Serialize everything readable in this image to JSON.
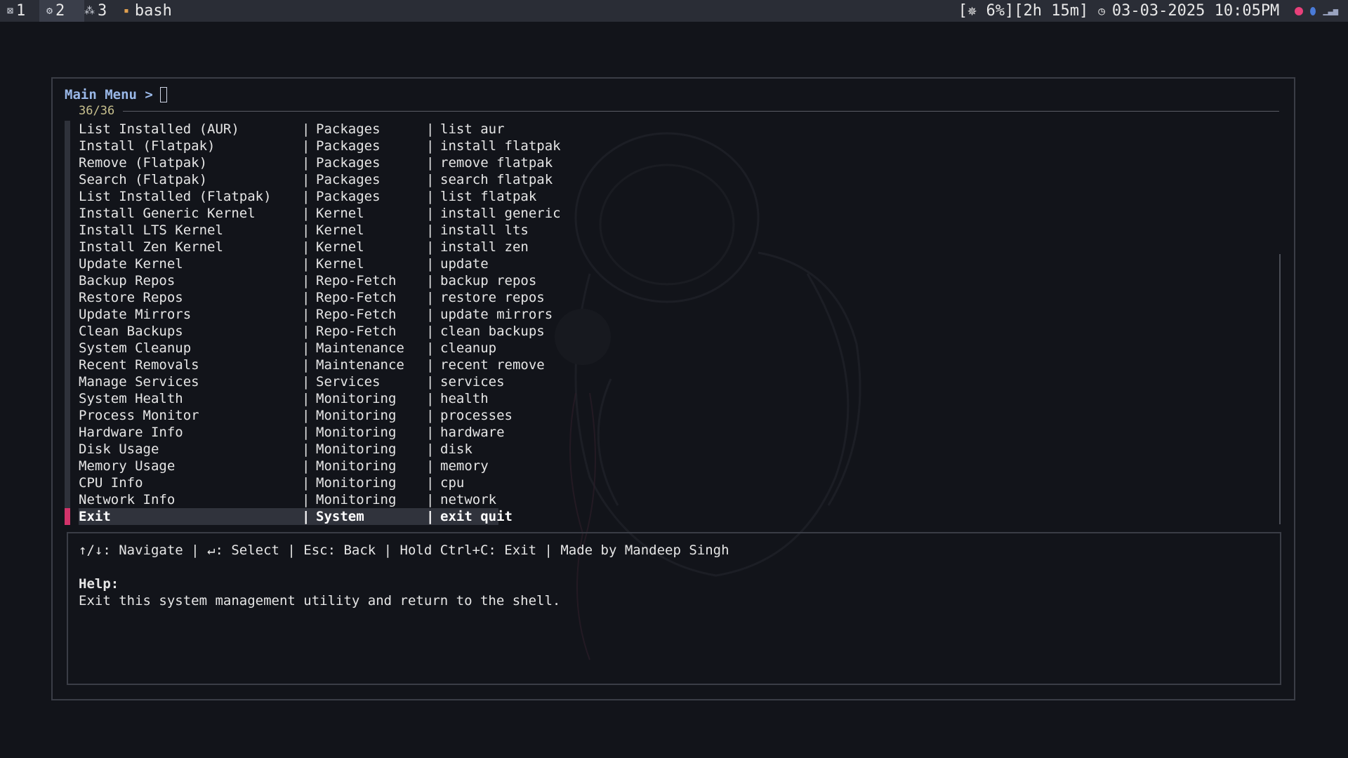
{
  "topbar": {
    "workspaces": [
      {
        "label": "1",
        "icon": "terminal-icon",
        "active": false
      },
      {
        "label": "2",
        "icon": "settings-icon",
        "active": true
      },
      {
        "label": "3",
        "icon": "nodes-icon",
        "active": false
      }
    ],
    "window_title": "bash",
    "status": {
      "cpu": "[✵ 6%]",
      "uptime": "[2h 15m]",
      "clock_icon": "◷",
      "datetime": "03-03-2025 10:05PM"
    },
    "tray_icons": [
      "firefox-icon",
      "bluetooth-icon",
      "signal-icon"
    ],
    "colors": {
      "bar_bg": "#2a2d36",
      "accent": "#d2336a"
    }
  },
  "menu": {
    "prompt": "Main Menu >",
    "counter": "36/36",
    "rows": [
      {
        "name": "List Installed (AUR)",
        "category": "Packages",
        "command": "list aur"
      },
      {
        "name": "Install (Flatpak)",
        "category": "Packages",
        "command": "install flatpak"
      },
      {
        "name": "Remove (Flatpak)",
        "category": "Packages",
        "command": "remove flatpak"
      },
      {
        "name": "Search (Flatpak)",
        "category": "Packages",
        "command": "search flatpak"
      },
      {
        "name": "List Installed (Flatpak)",
        "category": "Packages",
        "command": "list flatpak"
      },
      {
        "name": "Install Generic Kernel",
        "category": "Kernel",
        "command": "install generic"
      },
      {
        "name": "Install LTS Kernel",
        "category": "Kernel",
        "command": "install lts"
      },
      {
        "name": "Install Zen Kernel",
        "category": "Kernel",
        "command": "install zen"
      },
      {
        "name": "Update Kernel",
        "category": "Kernel",
        "command": "update"
      },
      {
        "name": "Backup Repos",
        "category": "Repo-Fetch",
        "command": "backup repos"
      },
      {
        "name": "Restore Repos",
        "category": "Repo-Fetch",
        "command": "restore repos"
      },
      {
        "name": "Update Mirrors",
        "category": "Repo-Fetch",
        "command": "update mirrors"
      },
      {
        "name": "Clean Backups",
        "category": "Repo-Fetch",
        "command": "clean backups"
      },
      {
        "name": "System Cleanup",
        "category": "Maintenance",
        "command": "cleanup"
      },
      {
        "name": "Recent Removals",
        "category": "Maintenance",
        "command": "recent remove"
      },
      {
        "name": "Manage Services",
        "category": "Services",
        "command": "services"
      },
      {
        "name": "System Health",
        "category": "Monitoring",
        "command": "health"
      },
      {
        "name": "Process Monitor",
        "category": "Monitoring",
        "command": "processes"
      },
      {
        "name": "Hardware Info",
        "category": "Monitoring",
        "command": "hardware"
      },
      {
        "name": "Disk Usage",
        "category": "Monitoring",
        "command": "disk"
      },
      {
        "name": "Memory Usage",
        "category": "Monitoring",
        "command": "memory"
      },
      {
        "name": "CPU Info",
        "category": "Monitoring",
        "command": "cpu"
      },
      {
        "name": "Network Info",
        "category": "Monitoring",
        "command": "network"
      },
      {
        "name": "Exit",
        "category": "System",
        "command": "exit quit",
        "selected": true
      }
    ],
    "separator": "|"
  },
  "help": {
    "keys": "↑/↓: Navigate | ↵: Select | Esc: Back | Hold Ctrl+C: Exit | Made by Mandeep Singh",
    "title": "Help:",
    "text": "Exit this system management utility and return to the shell."
  }
}
